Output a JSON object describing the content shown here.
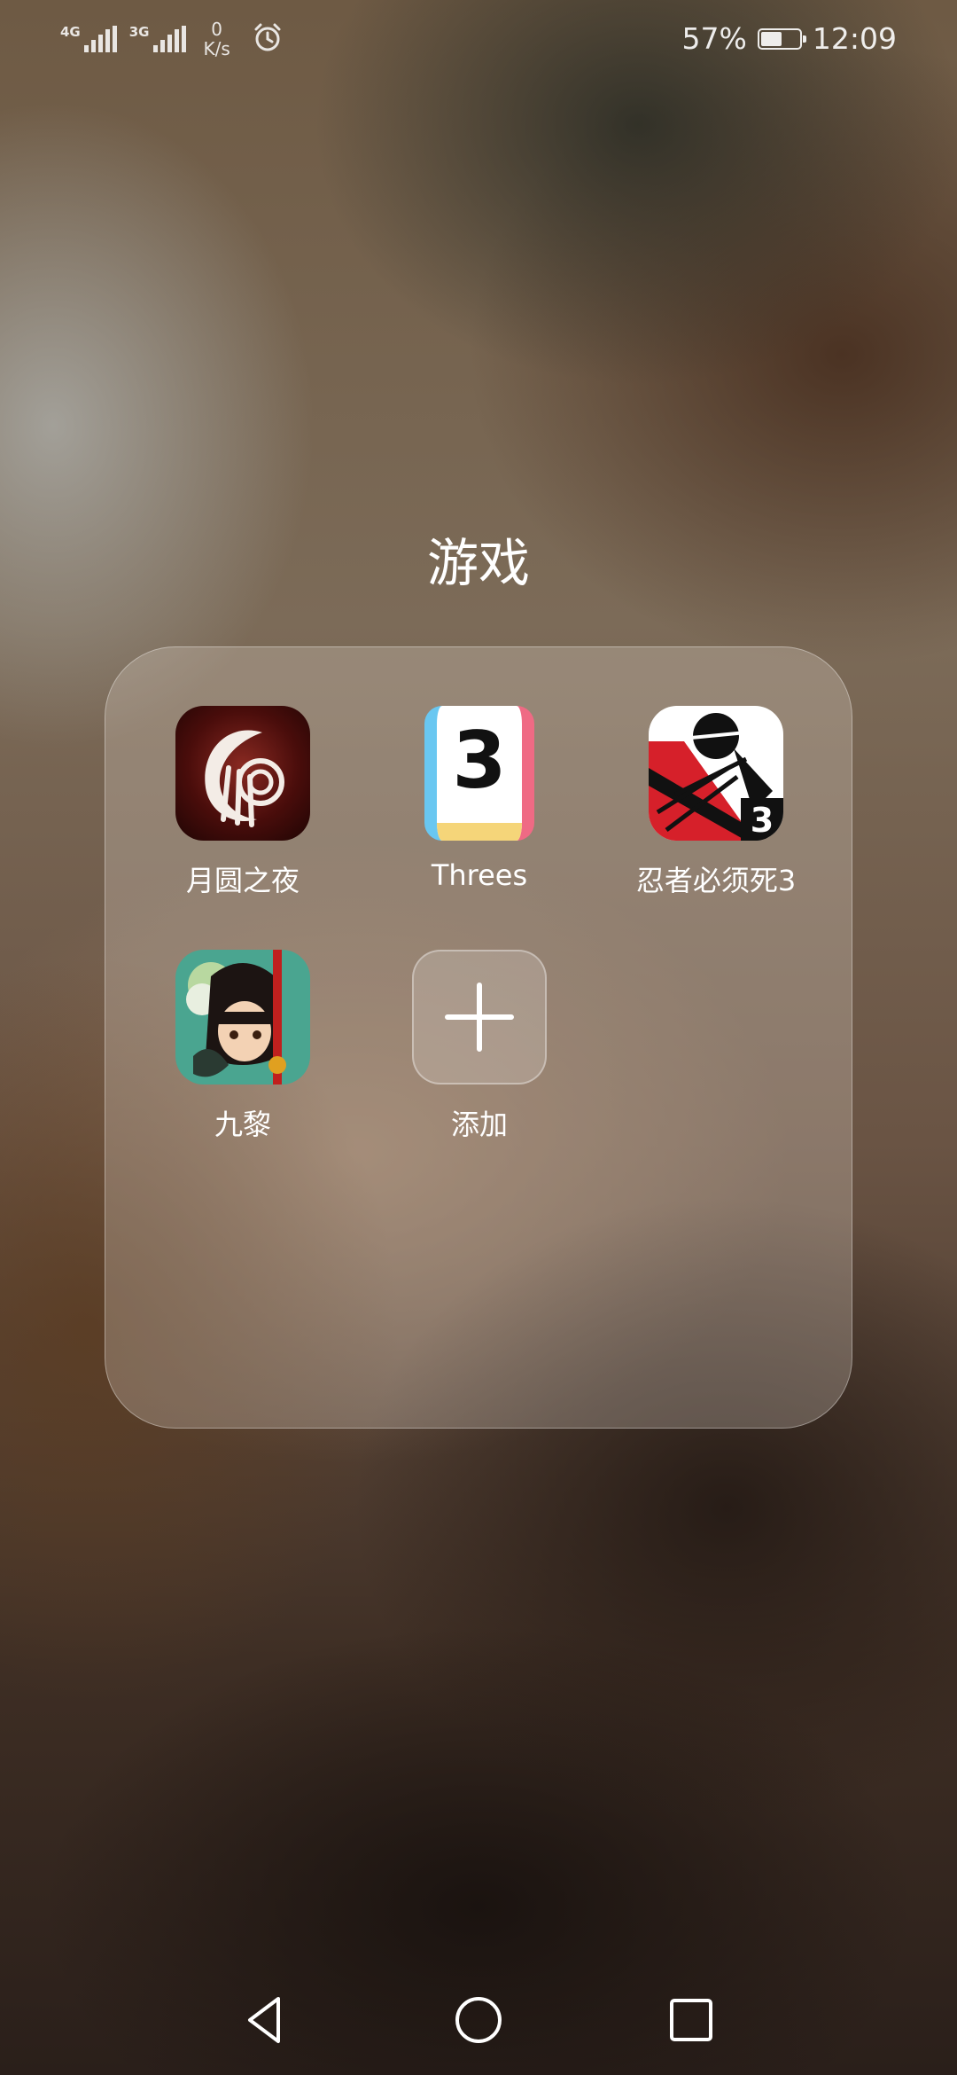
{
  "status_bar": {
    "network_1": "4G",
    "network_2": "3G",
    "speed_value": "0",
    "speed_unit": "K/s",
    "battery_percent": "57%",
    "battery_level": 0.57,
    "time": "12:09"
  },
  "folder": {
    "title": "游戏",
    "apps": [
      {
        "label": "月圆之夜",
        "icon": "moon-night-app-icon"
      },
      {
        "label": "Threes",
        "icon": "threes-app-icon",
        "icon_text": "3"
      },
      {
        "label": "忍者必须死3",
        "icon": "ninja-must-die-3-app-icon",
        "icon_text": "3"
      },
      {
        "label": "九黎",
        "icon": "jiuli-app-icon"
      }
    ],
    "add": {
      "label": "添加",
      "icon": "plus-icon"
    }
  },
  "nav_bar": {
    "back": "back-triangle-icon",
    "home": "home-circle-icon",
    "recents": "recents-square-icon"
  }
}
